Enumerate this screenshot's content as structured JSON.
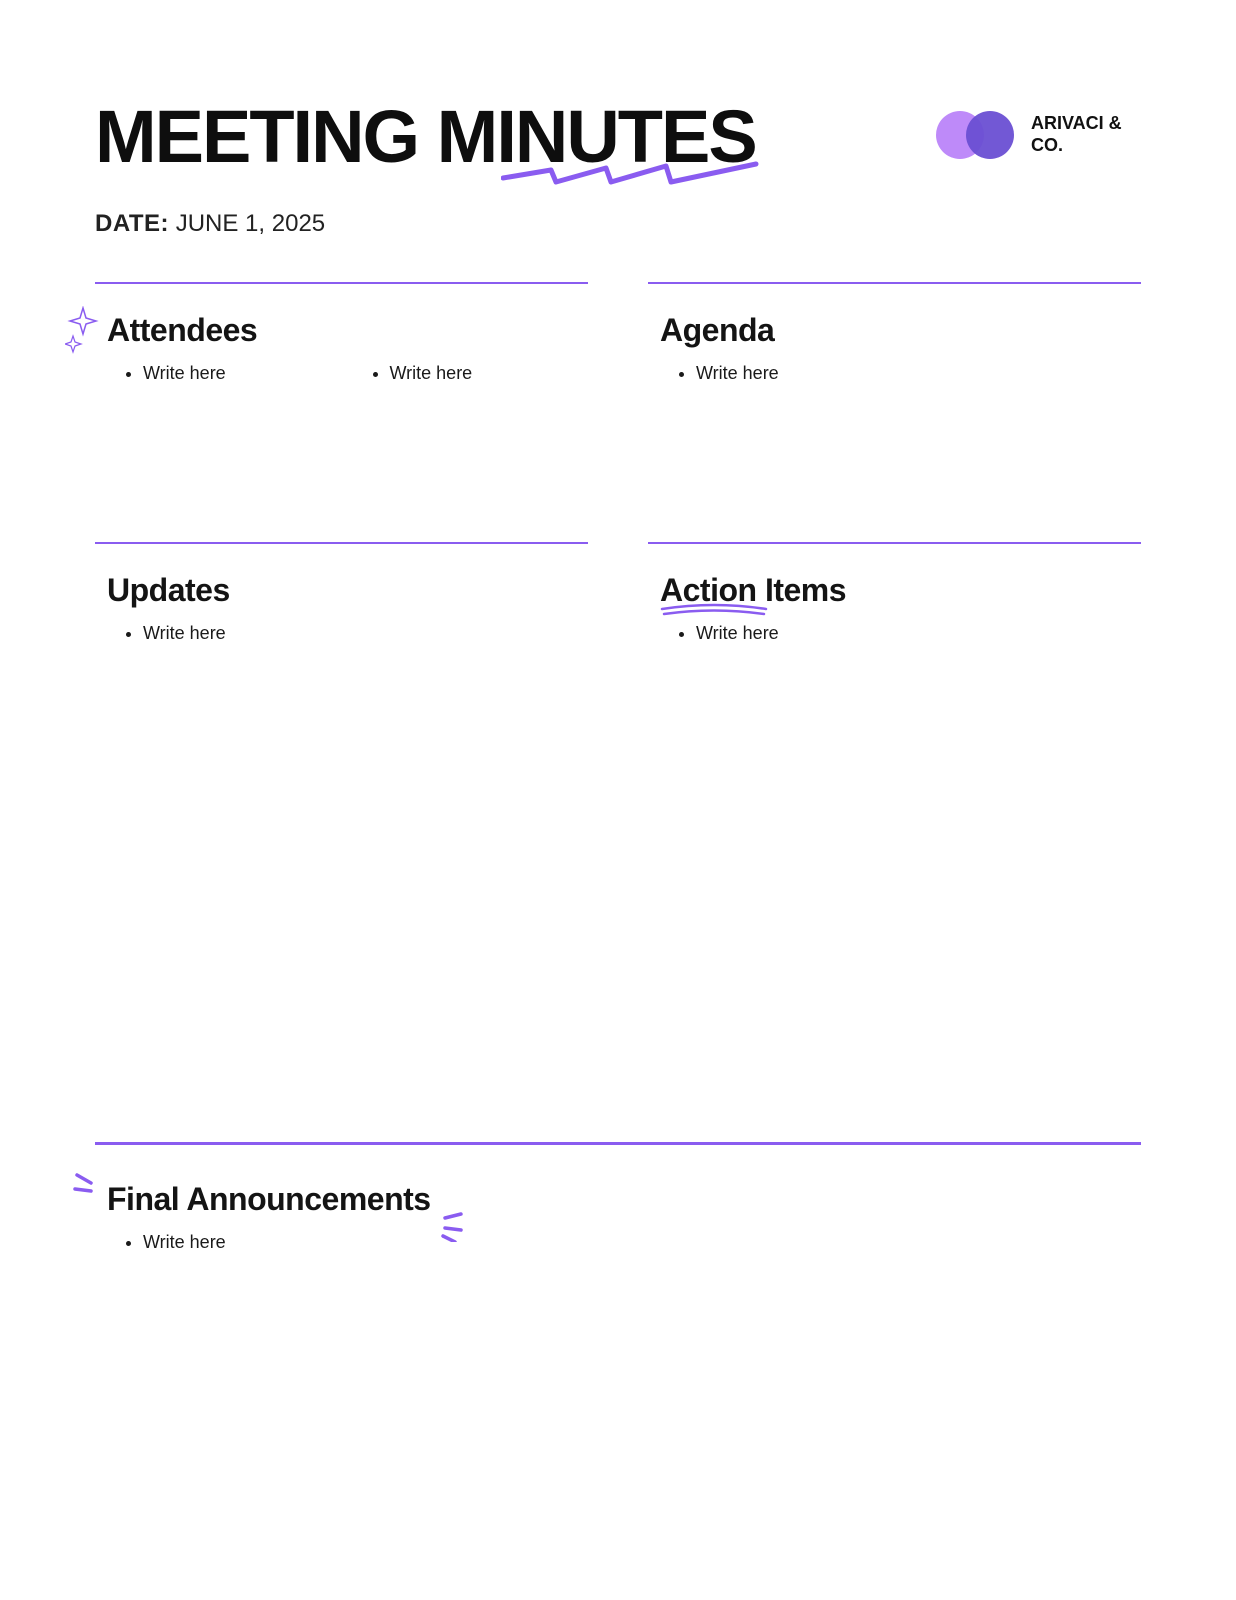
{
  "header": {
    "title": "MEETING MINUTES",
    "company": "ARIVACI & CO."
  },
  "date": {
    "label": "DATE:",
    "value": "JUNE 1, 2025"
  },
  "sections": {
    "attendees": {
      "title": "Attendees",
      "col1": "Write here",
      "col2": "Write here"
    },
    "agenda": {
      "title": "Agenda",
      "item": "Write here"
    },
    "updates": {
      "title": "Updates",
      "item": "Write here"
    },
    "action_items": {
      "title_word1": "Action",
      "title_word2": "Items",
      "item": "Write here"
    },
    "final": {
      "title": "Final Announcements",
      "item": "Write here"
    }
  },
  "colors": {
    "accent": "#8a5cf0"
  }
}
